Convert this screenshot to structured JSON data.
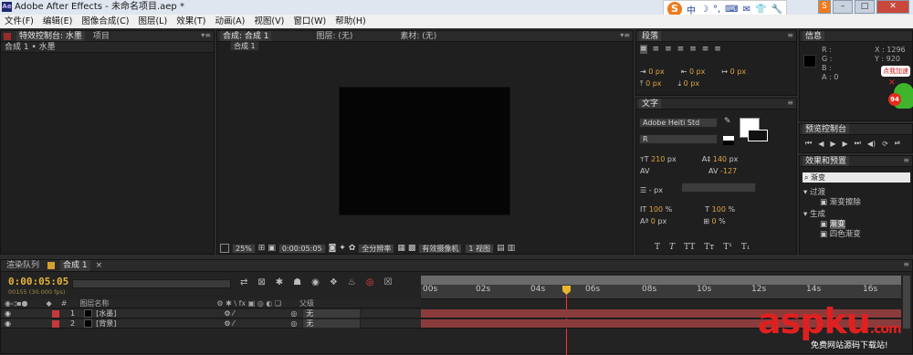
{
  "window": {
    "title": "Adobe After Effects - 未命名项目.aep *",
    "logo_text": "Ae",
    "min": "–",
    "max": "□",
    "close": "✕"
  },
  "menu": [
    "文件(F)",
    "编辑(E)",
    "图像合成(C)",
    "图层(L)",
    "效果(T)",
    "动画(A)",
    "视图(V)",
    "窗口(W)",
    "帮助(H)"
  ],
  "ime": {
    "logo": "S",
    "lang": "中",
    "items": [
      "☽",
      "°,",
      "⌨",
      "✉",
      "👕",
      "🔧"
    ],
    "right_btn": "S"
  },
  "effects_panel": {
    "tab1": "特效控制台: 水墨",
    "tab2": "项目",
    "header": "合成 1 • 水墨"
  },
  "comp_panel": {
    "tab1": "合成: 合成 1",
    "tab2": "图层: (无)",
    "tab3": "素材: (无)",
    "subtab": "合成 1",
    "zoom": "25%",
    "timecode": "0:00:05:05",
    "resolution": "全分辨率",
    "camera": "有效摄像机",
    "views": "1 视图"
  },
  "paragraph": {
    "title": "段落",
    "values": [
      "0 px",
      "0 px",
      "0 px",
      "0 px",
      "0 px"
    ]
  },
  "character": {
    "title": "文字",
    "font": "Adobe Heiti Std",
    "style": "R",
    "size": "210",
    "size_unit": "px",
    "leading": "140",
    "leading_unit": "px",
    "tracking": "-127",
    "baseline_unit": "- px",
    "vscale": "100",
    "hscale": "100",
    "shift": "0",
    "shift_unit": "px",
    "tsume": "0",
    "tsume_unit": "%",
    "pct": "%",
    "styles": [
      "T",
      "T",
      "TT",
      "Tт",
      "T¹",
      "T₁"
    ]
  },
  "info": {
    "title": "信息",
    "labels": [
      "R :",
      "G :",
      "B :",
      "A : 0"
    ],
    "x": "X : 1296",
    "y": "Y : 920",
    "ad": "点我加速",
    "badge": "94"
  },
  "preview": {
    "title": "预览控制台",
    "controls": [
      "⏮",
      "◀",
      "▶",
      "▶",
      "⏭",
      "◀)",
      "⟳",
      "⏯"
    ]
  },
  "effects_presets": {
    "title": "效果和预置",
    "search": "渐变",
    "group1": "过渡",
    "item1": "渐变擦除",
    "group2": "生成",
    "item2": "渐变",
    "item3": "四色渐变"
  },
  "timeline": {
    "tab1": "渲染队列",
    "tab2": "合成 1",
    "timecode": "0:00:05:05",
    "fps": "00155 (30.000 fps)",
    "col_name": "图层名称",
    "col_parent": "父级",
    "ticks": [
      "00s",
      "02s",
      "04s",
      "06s",
      "08s",
      "10s",
      "12s",
      "14s",
      "16s"
    ],
    "layers": [
      {
        "num": "1",
        "name": "[水墨]",
        "parent": "无"
      },
      {
        "num": "2",
        "name": "[背景]",
        "parent": "无"
      }
    ]
  },
  "watermark": {
    "brand": "aspku",
    "tld": ".com",
    "tagline": "免费网站源码下载站!"
  }
}
